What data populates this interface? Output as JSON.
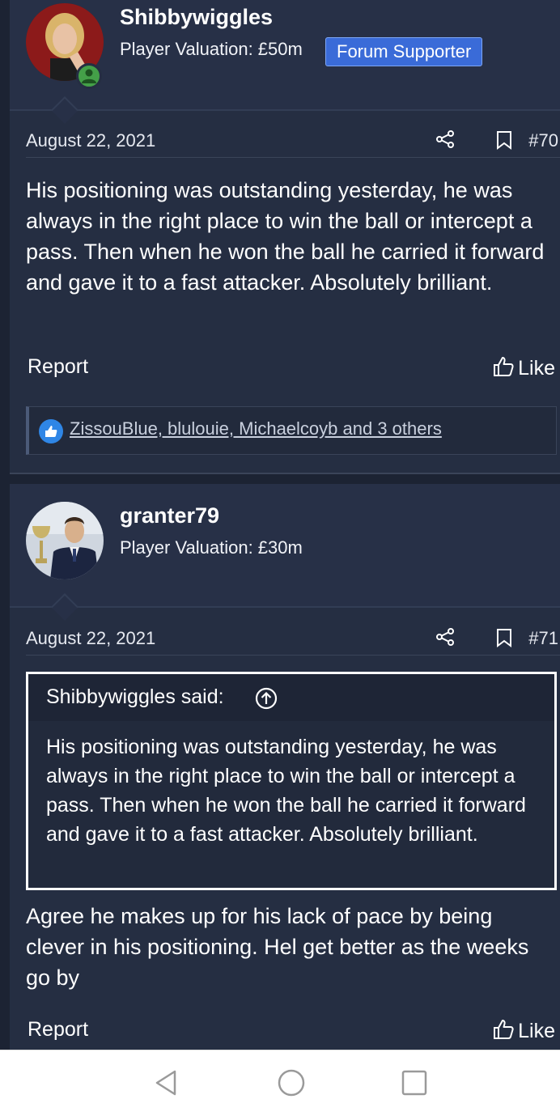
{
  "posts": [
    {
      "username": "Shibbywiggles",
      "valuation": "Player Valuation: £50m",
      "badge": "Forum Supporter",
      "date": "August 22, 2021",
      "post_number": "#70",
      "body": "His positioning was outstanding yesterday, he was always in the right place to win the ball or intercept a pass. Then when he won the ball he carried it forward and gave it to a fast attacker. Absolutely brilliant.",
      "report_label": "Report",
      "like_label": "Like",
      "reactions_text": "ZissouBlue, blulouie, Michaelcoyb and 3 others"
    },
    {
      "username": "granter79",
      "valuation": "Player Valuation: £30m",
      "date": "August 22, 2021",
      "post_number": "#71",
      "quote_author": "Shibbywiggles said:",
      "quote_text": "His positioning was outstanding yesterday, he was always in the right place to win the ball or intercept a pass. Then when he won the ball he carried it forward and gave it to a fast attacker. Absolutely brilliant.",
      "body": "Agree he makes up for his lack of pace by being clever in his positioning. Hel get better as the weeks go by",
      "report_label": "Report",
      "like_label": "Like"
    }
  ],
  "icons": {
    "share": "share-icon",
    "bookmark": "bookmark-icon",
    "like": "thumbs-up-icon",
    "quote_up": "arrow-up-circle-icon",
    "online": "online-status-icon",
    "reaction": "like-reaction-icon"
  },
  "navbar": {
    "back": "back-nav-icon",
    "home": "home-nav-icon",
    "recents": "recents-nav-icon"
  },
  "colors": {
    "background": "#1c2333",
    "post": "#252e42",
    "badge": "#3a6bd8",
    "online": "#44a048",
    "reaction": "#2f86e6"
  }
}
